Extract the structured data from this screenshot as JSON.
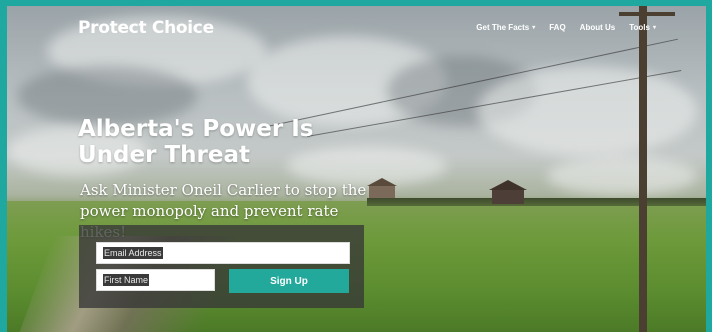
{
  "brand": "Protect Choice",
  "nav": {
    "items": [
      {
        "label": "Get The Facts",
        "has_dropdown": true
      },
      {
        "label": "FAQ",
        "has_dropdown": false
      },
      {
        "label": "About Us",
        "has_dropdown": false
      },
      {
        "label": "Tools",
        "has_dropdown": true
      }
    ]
  },
  "hero": {
    "headline_line1": "Alberta's Power Is",
    "headline_line2": "Under Threat",
    "subhead_line1": "Ask Minister Oneil Carlier to stop the",
    "subhead_line2": "power monopoly and prevent rate hikes!"
  },
  "form": {
    "email_placeholder": "Email Address",
    "first_name_placeholder": "First Name",
    "signup_label": "Sign Up"
  },
  "colors": {
    "accent": "#22a99c",
    "border": "#1fa8a0"
  }
}
